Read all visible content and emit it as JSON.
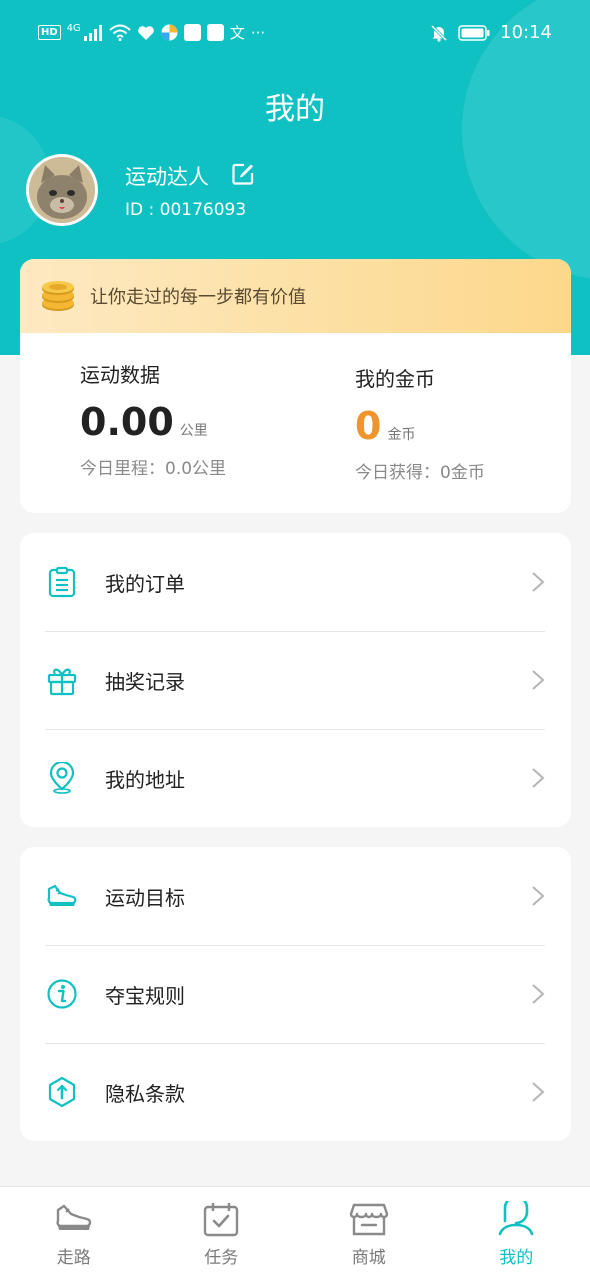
{
  "status_bar": {
    "hd": "HD",
    "network": "4G",
    "text_glyph": "文",
    "more": "···",
    "time": "10:14"
  },
  "header": {
    "title": "我的"
  },
  "profile": {
    "username": "运动达人",
    "id_text": "ID : 00176093"
  },
  "slogan": "让你走过的每一步都有价值",
  "sport": {
    "label": "运动数据",
    "value": "0.00",
    "unit": "公里",
    "sub": "今日里程：0.0公里"
  },
  "coins": {
    "label": "我的金币",
    "value": "0",
    "unit": "金币",
    "sub": "今日获得：0金币"
  },
  "menu_group_1": [
    {
      "label": "我的订单",
      "icon": "clipboard-icon"
    },
    {
      "label": "抽奖记录",
      "icon": "gift-icon"
    },
    {
      "label": "我的地址",
      "icon": "location-icon"
    }
  ],
  "menu_group_2": [
    {
      "label": "运动目标",
      "icon": "sneaker-icon"
    },
    {
      "label": "夺宝规则",
      "icon": "info-icon"
    },
    {
      "label": "隐私条款",
      "icon": "shield-icon"
    }
  ],
  "tabs": [
    {
      "label": "走路",
      "icon": "shoe-icon"
    },
    {
      "label": "任务",
      "icon": "calendar-check-icon"
    },
    {
      "label": "商城",
      "icon": "store-icon"
    },
    {
      "label": "我的",
      "icon": "person-icon",
      "active": true
    }
  ],
  "colors": {
    "primary": "#10c1c4",
    "coin": "#f0952b",
    "slogan_start": "#fde9c2",
    "slogan_end": "#fcd88b"
  }
}
